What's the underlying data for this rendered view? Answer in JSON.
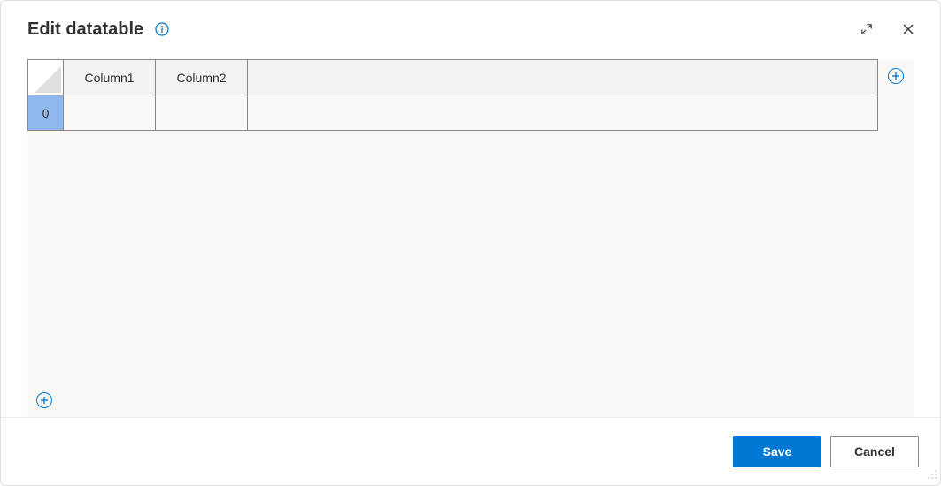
{
  "dialog": {
    "title": "Edit datatable"
  },
  "table": {
    "columns": [
      "Column1",
      "Column2"
    ],
    "rows": [
      {
        "index": "0",
        "cells": [
          "",
          ""
        ]
      }
    ]
  },
  "footer": {
    "save_label": "Save",
    "cancel_label": "Cancel"
  }
}
